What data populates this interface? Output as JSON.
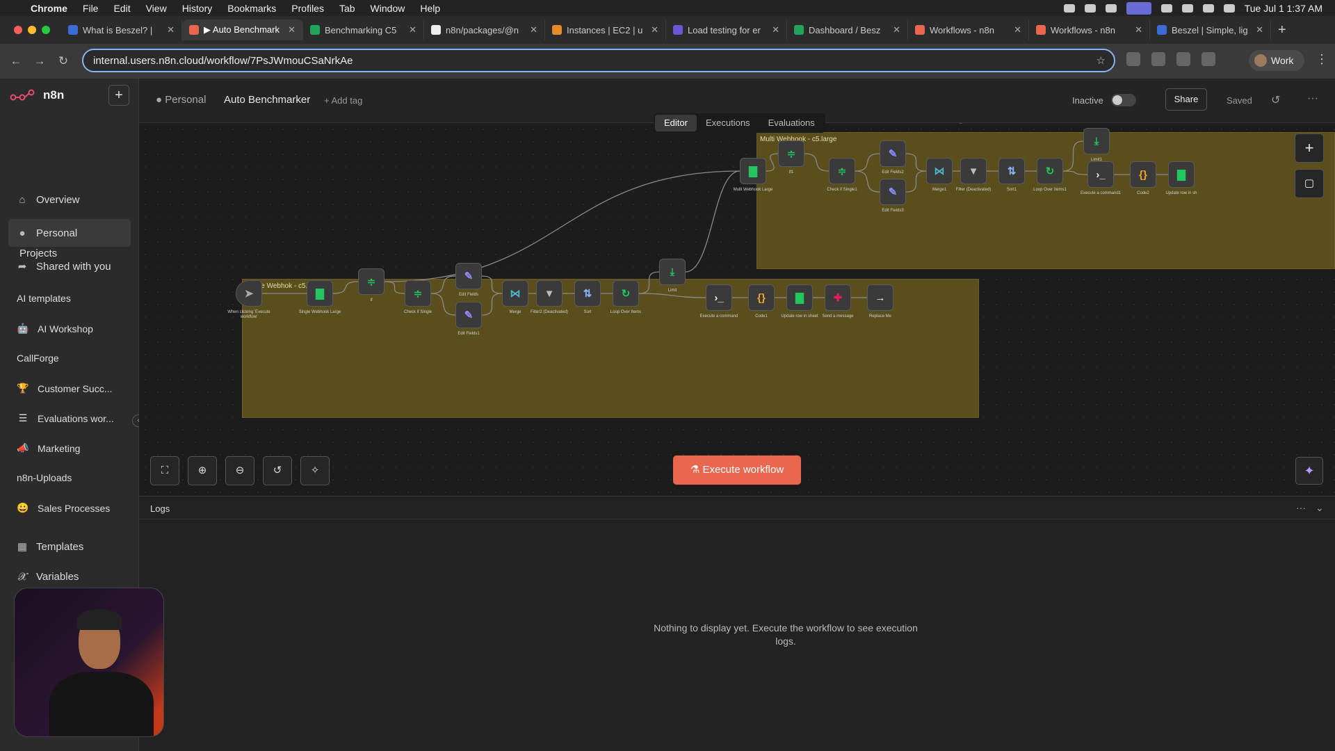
{
  "mac_menu": {
    "app": "Chrome",
    "items": [
      "File",
      "Edit",
      "View",
      "History",
      "Bookmarks",
      "Profiles",
      "Tab",
      "Window",
      "Help"
    ],
    "clock": "Tue Jul 1  1:37 AM"
  },
  "tabs": [
    {
      "title": "What is Beszel? | ",
      "color": "#3b6bd6"
    },
    {
      "title": "▶ Auto Benchmark",
      "color": "#e9674f",
      "active": true
    },
    {
      "title": "Benchmarking C5",
      "color": "#22a35a"
    },
    {
      "title": "n8n/packages/@n",
      "color": "#eeeeee"
    },
    {
      "title": "Instances | EC2 | u",
      "color": "#e78a2b"
    },
    {
      "title": "Load testing for er",
      "color": "#6b57d6"
    },
    {
      "title": "Dashboard / Besz",
      "color": "#22a35a"
    },
    {
      "title": "Workflows - n8n",
      "color": "#e9674f"
    },
    {
      "title": "Workflows - n8n",
      "color": "#e9674f"
    },
    {
      "title": "Beszel | Simple, lig",
      "color": "#3b6bd6"
    }
  ],
  "address": {
    "url": "internal.users.n8n.cloud/workflow/7PsJWmouCSaNrkAe"
  },
  "profile": {
    "label": "Work"
  },
  "sidebar": {
    "brand": "n8n",
    "nav": [
      "Overview",
      "Personal",
      "Shared with you"
    ],
    "projects_header": "Projects",
    "projects": [
      {
        "label": "AI templates",
        "icon": ""
      },
      {
        "label": "AI Workshop",
        "icon": "🤖"
      },
      {
        "label": "CallForge",
        "icon": ""
      },
      {
        "label": "Customer Succ...",
        "icon": "🏆"
      },
      {
        "label": "Evaluations wor...",
        "icon": "☰"
      },
      {
        "label": "Marketing",
        "icon": "📣"
      },
      {
        "label": "n8n-Uploads",
        "icon": ""
      },
      {
        "label": "Sales Processes",
        "icon": "😀"
      }
    ],
    "bottom": [
      "Templates",
      "Variables"
    ]
  },
  "header": {
    "project": "Personal",
    "workflow": "Auto Benchmarker",
    "add_tag": "+ Add tag",
    "status": "Inactive",
    "share": "Share",
    "saved": "Saved"
  },
  "view_tabs": [
    "Editor",
    "Executions",
    "Evaluations"
  ],
  "canvas": {
    "sticky_single": "Single Webhok - c5.large",
    "sticky_multi": "Multi Webhook - c5.large",
    "nodes": [
      {
        "id": "trigger",
        "label": "When clicking 'Execute workflow'",
        "glyph": "➤",
        "color": "#aaaaaa"
      },
      {
        "id": "swl",
        "label": "Single Webhook Large",
        "glyph": "▇",
        "color": "#22c55e"
      },
      {
        "id": "if",
        "label": "If",
        "glyph": "≑",
        "color": "#22c55e"
      },
      {
        "id": "cis",
        "label": "Check if Single",
        "glyph": "≑",
        "color": "#22c55e"
      },
      {
        "id": "ef",
        "label": "Edit Fields",
        "glyph": "✎",
        "color": "#8b8bf5"
      },
      {
        "id": "ef1",
        "label": "Edit Fields1",
        "glyph": "✎",
        "color": "#8b8bf5"
      },
      {
        "id": "merge",
        "label": "Merge",
        "glyph": "⋈",
        "color": "#4fb3c9"
      },
      {
        "id": "filter2",
        "label": "Filter2 (Deactivated)",
        "glyph": "▼",
        "color": "#bbbbbb"
      },
      {
        "id": "sort",
        "label": "Sort",
        "glyph": "⇅",
        "color": "#8ab4f8"
      },
      {
        "id": "loop",
        "label": "Loop Over Items",
        "glyph": "↻",
        "color": "#22c55e"
      },
      {
        "id": "limit",
        "label": "Limit",
        "glyph": "⤓",
        "color": "#22c55e"
      },
      {
        "id": "exec",
        "label": "Execute a command",
        "glyph": "›_",
        "color": "#eeeeee"
      },
      {
        "id": "code",
        "label": "Code1",
        "glyph": "{}",
        "color": "#f5a623"
      },
      {
        "id": "upd",
        "label": "Update row in sheet",
        "glyph": "▇",
        "color": "#22c55e"
      },
      {
        "id": "slack",
        "label": "Send a message",
        "glyph": "✚",
        "color": "#e01e5a"
      },
      {
        "id": "replace",
        "label": "Replace Me",
        "glyph": "→",
        "color": "#eeeeee"
      },
      {
        "id": "mwl",
        "label": "Multi Webhook Large",
        "glyph": "▇",
        "color": "#22c55e"
      },
      {
        "id": "if1",
        "label": "If1",
        "glyph": "≑",
        "color": "#22c55e"
      },
      {
        "id": "cis1",
        "label": "Check if Single1",
        "glyph": "≑",
        "color": "#22c55e"
      },
      {
        "id": "ef2",
        "label": "Edit Fields2",
        "glyph": "✎",
        "color": "#8b8bf5"
      },
      {
        "id": "ef3",
        "label": "Edit Fields3",
        "glyph": "✎",
        "color": "#8b8bf5"
      },
      {
        "id": "merge1",
        "label": "Merge1",
        "glyph": "⋈",
        "color": "#4fb3c9"
      },
      {
        "id": "filter",
        "label": "Filter (Deactivated)",
        "glyph": "▼",
        "color": "#bbbbbb"
      },
      {
        "id": "sort1",
        "label": "Sort1",
        "glyph": "⇅",
        "color": "#8ab4f8"
      },
      {
        "id": "loop1",
        "label": "Loop Over Items1",
        "glyph": "↻",
        "color": "#22c55e"
      },
      {
        "id": "limit1",
        "label": "Limit1",
        "glyph": "⤓",
        "color": "#22c55e"
      },
      {
        "id": "exec1",
        "label": "Execute a command1",
        "glyph": "›_",
        "color": "#eeeeee"
      },
      {
        "id": "code2",
        "label": "Code2",
        "glyph": "{}",
        "color": "#f5a623"
      },
      {
        "id": "upd1",
        "label": "Update row in sh",
        "glyph": "▇",
        "color": "#22c55e"
      }
    ]
  },
  "controls": {
    "execute": "Execute workflow"
  },
  "logs": {
    "title": "Logs",
    "empty": "Nothing to display yet. Execute the workflow to see execution logs."
  },
  "icons": {
    "zoom_fit": "fit-view-icon",
    "zoom_in": "zoom-in-icon",
    "zoom_out": "zoom-out-icon",
    "reset": "reset-zoom-icon",
    "tidy": "tidy-up-icon"
  }
}
